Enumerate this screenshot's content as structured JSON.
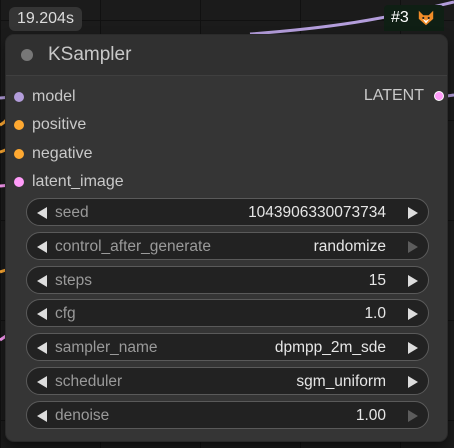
{
  "execution_time": "19.204s",
  "badge": {
    "id": "#3",
    "icon": "fox-icon"
  },
  "node": {
    "title": "KSampler",
    "inputs": [
      {
        "label": "model",
        "color": "#b39ddb"
      },
      {
        "label": "positive",
        "color": "#ffa931"
      },
      {
        "label": "negative",
        "color": "#ffa931"
      },
      {
        "label": "latent_image",
        "color": "#ff9cf9"
      }
    ],
    "output": {
      "label": "LATENT",
      "color": "#ff9cf9"
    },
    "widgets": [
      {
        "label": "seed",
        "value": "1043906330073734"
      },
      {
        "label": "control_after_generate",
        "value": "randomize"
      },
      {
        "label": "steps",
        "value": "15"
      },
      {
        "label": "cfg",
        "value": "1.0"
      },
      {
        "label": "sampler_name",
        "value": "dpmpp_2m_sde"
      },
      {
        "label": "scheduler",
        "value": "sgm_uniform"
      },
      {
        "label": "denoise",
        "value": "1.00"
      }
    ]
  }
}
